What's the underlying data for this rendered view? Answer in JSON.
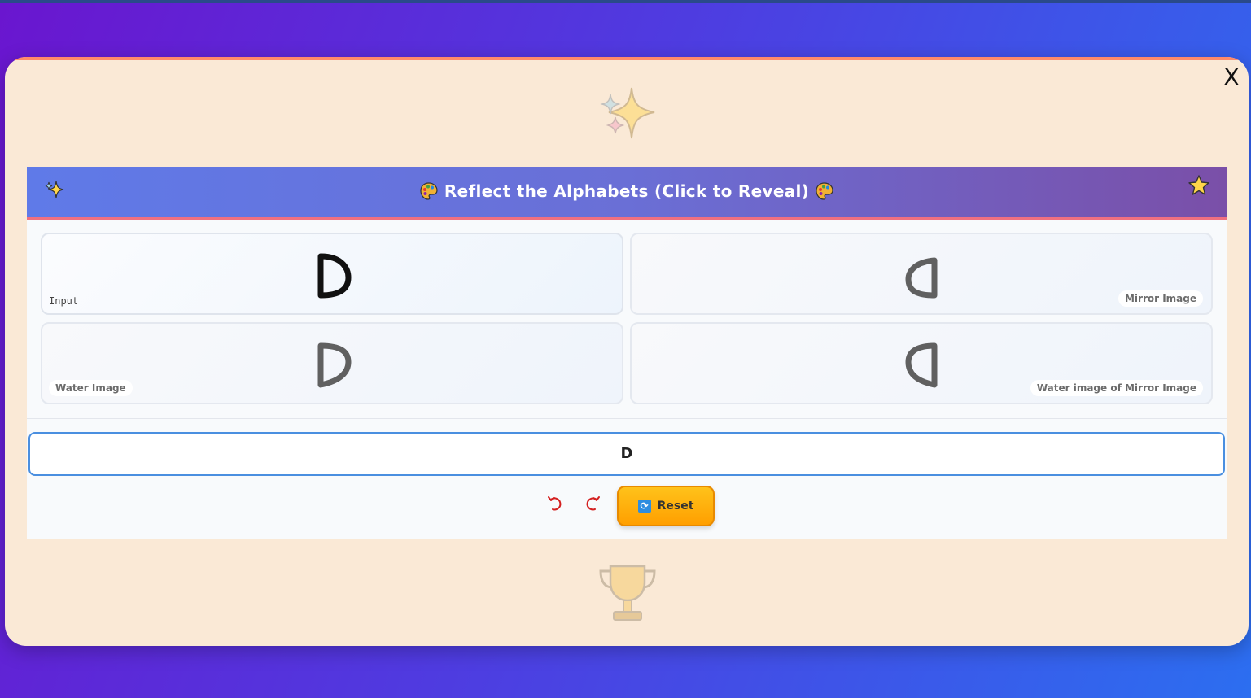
{
  "header": {
    "title": "Reflect the Alphabets (Click to Reveal)"
  },
  "cards": {
    "input": {
      "label": "Input",
      "letter": "D"
    },
    "mirror": {
      "label": "Mirror Image"
    },
    "water": {
      "label": "Water Image"
    },
    "water_mirror": {
      "label": "Water image of Mirror Image"
    }
  },
  "input_field": {
    "value": "D"
  },
  "controls": {
    "reset_label": "Reset",
    "undo_icon": "undo-arrow-icon",
    "redo_icon": "redo-arrow-icon"
  },
  "close_label": "X",
  "colors": {
    "accent": "#ff9f00",
    "header_start": "#5f7ae8",
    "header_end": "#7a4fa8",
    "input_border": "#4a8fe0",
    "control_red": "#d42020"
  }
}
